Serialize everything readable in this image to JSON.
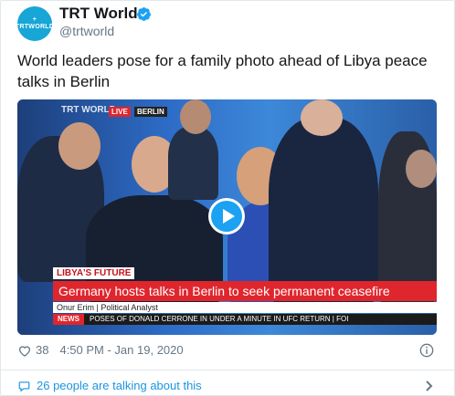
{
  "author": {
    "name": "TRT World",
    "handle": "@trtworld",
    "avatar_text": "TRTWORLD",
    "avatar_small": "+"
  },
  "tweet": {
    "text": "World leaders pose for a family photo ahead of Libya peace talks in Berlin"
  },
  "video": {
    "watermark": "TRT WORLD",
    "live_label": "LIVE",
    "location": "BERLIN",
    "topic": "LIBYA'S FUTURE",
    "headline": "Germany hosts talks in Berlin to seek permanent ceasefire",
    "speaker": "Onur Erim | Political Analyst",
    "ticker_tag": "NEWS",
    "ticker_text": "POSES OF DONALD CERRONE IN UNDER A MINUTE IN UFC RETURN  |  FOI"
  },
  "meta": {
    "likes": "38",
    "timestamp": "4:50 PM - Jan 19, 2020"
  },
  "footer": {
    "talking": "26 people are talking about this"
  },
  "colors": {
    "accent": "#1da1f2",
    "link": "#1b95e0",
    "trt_blue": "#17a6d6",
    "news_red": "#e0262d"
  }
}
